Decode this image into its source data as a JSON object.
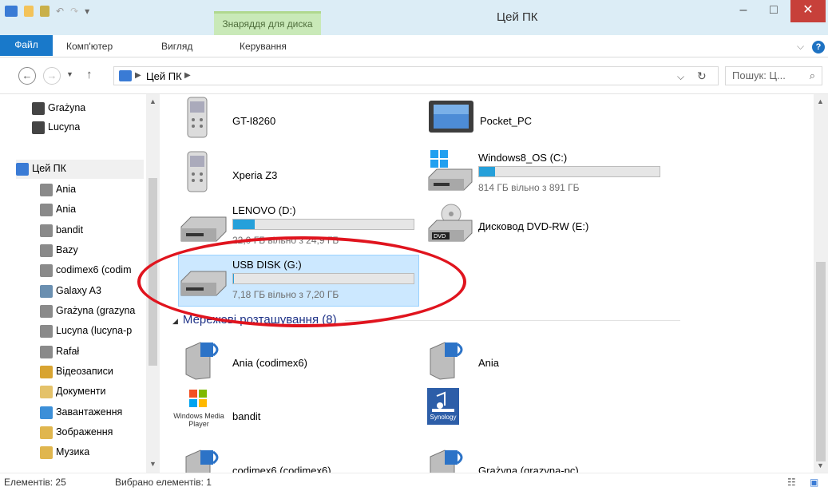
{
  "window": {
    "title": "Цей ПК",
    "context_tab": "Знаряддя для диска"
  },
  "ribbon": {
    "tabs": [
      "Файл",
      "Комп'ютер",
      "Вигляд",
      "Керування"
    ]
  },
  "address": {
    "crumb": "Цей ПК",
    "search_placeholder": "Пошук: Ц..."
  },
  "sidebar": {
    "items": [
      {
        "label": "Grażyna"
      },
      {
        "label": "Lucyna"
      },
      {
        "label": "Цей ПК"
      },
      {
        "label": "Ania"
      },
      {
        "label": "Ania"
      },
      {
        "label": "bandit"
      },
      {
        "label": "Bazy"
      },
      {
        "label": "codimex6 (codim"
      },
      {
        "label": "Galaxy A3"
      },
      {
        "label": "Grażyna (grazyna"
      },
      {
        "label": "Lucyna (lucyna-p"
      },
      {
        "label": "Rafał"
      },
      {
        "label": "Відеозаписи"
      },
      {
        "label": "Документи"
      },
      {
        "label": "Завантаження"
      },
      {
        "label": "Зображення"
      },
      {
        "label": "Музика"
      }
    ]
  },
  "devices": [
    {
      "name": "GT-I8260"
    },
    {
      "name": "Pocket_PC"
    },
    {
      "name": "Xperia Z3"
    },
    {
      "name": "Windows8_OS (C:)",
      "space": "814 ГБ вільно з 891 ГБ",
      "used_fraction": 0.09
    },
    {
      "name": "LENOVO (D:)",
      "space": "22,0 ГБ вільно з 24,9 ГБ",
      "used_fraction": 0.12
    },
    {
      "name": "Дисковод DVD-RW (E:)"
    },
    {
      "name": "USB DISK (G:)",
      "space": "7,18 ГБ вільно з 7,20 ГБ",
      "used_fraction": 0.003
    }
  ],
  "network_group": {
    "label": "Мережеві розташування (8)"
  },
  "network": [
    {
      "name": "Ania (codimex6)"
    },
    {
      "name": "Ania"
    },
    {
      "name": "bandit",
      "logo_text": "Windows Media Player"
    },
    {
      "name": "",
      "logo_text": "Synology"
    },
    {
      "name": "codimex6 (codimex6)"
    },
    {
      "name": "Grażyna (grazyna-pc)"
    }
  ],
  "status": {
    "count": "Елементів: 25",
    "selected": "Вибрано елементів: 1"
  },
  "colors": {
    "accent": "#1979ca",
    "progress": "#26a0da",
    "selection": "#cce8ff",
    "annotation": "#e0141e"
  }
}
